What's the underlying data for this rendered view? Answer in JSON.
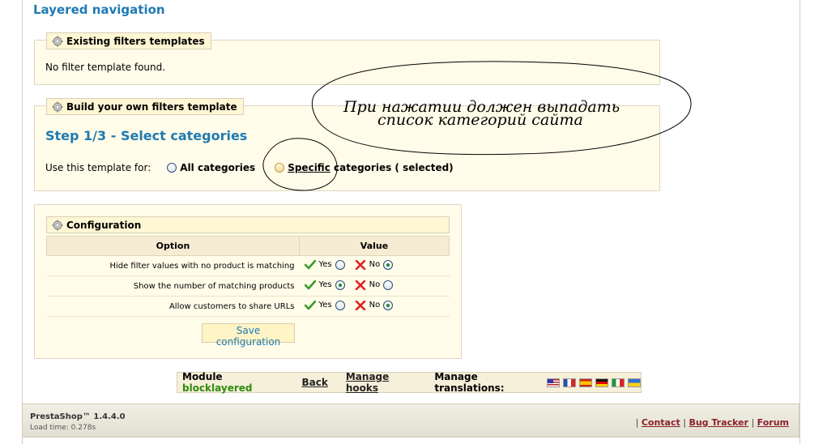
{
  "page_title": "Layered navigation",
  "existing": {
    "legend": "Existing filters templates",
    "empty_text": "No filter template found."
  },
  "build": {
    "legend": "Build your own filters template",
    "step_title": "Step 1/3 - Select categories",
    "use_label": "Use this template for:",
    "option_all": "All categories",
    "option_specific_link": "Specific",
    "option_specific_rest": "categories ( selected)"
  },
  "config": {
    "legend": "Configuration",
    "col_option": "Option",
    "col_value": "Value",
    "yes_label": "Yes",
    "no_label": "No",
    "rows": [
      {
        "option": "Hide filter values with no product is matching",
        "selected": "no"
      },
      {
        "option": "Show the number of matching products",
        "selected": "yes"
      },
      {
        "option": "Allow customers to share URLs",
        "selected": "no"
      }
    ],
    "save_label": "Save configuration"
  },
  "module_bar": {
    "module_prefix": "Module",
    "module_name": "blocklayered",
    "back": "Back",
    "manage_hooks": "Manage hooks",
    "manage_translations": "Manage translations:",
    "flags": [
      "flag-en-icon",
      "flag-fr-icon",
      "flag-es-icon",
      "flag-de-icon",
      "flag-it-icon",
      "flag-ua-icon"
    ]
  },
  "footer": {
    "version": "PrestaShop™ 1.4.4.0",
    "load_time": "Load time: 0.278s",
    "contact": "Contact",
    "bug_tracker": "Bug Tracker",
    "forum": "Forum"
  },
  "annotation": {
    "line1": "При нажатии должен выпадать",
    "line2": "список  категорий сайта"
  },
  "colors": {
    "accent": "#1f7ab3",
    "module_name": "#2e8b0e",
    "footer_link": "#8a1f2a"
  }
}
